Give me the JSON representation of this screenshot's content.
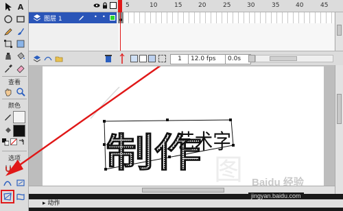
{
  "tools": {
    "view_label": "查看",
    "color_label": "颜色",
    "options_label": "选项"
  },
  "timeline": {
    "layer_name": "图层 1",
    "ruler_numbers": [
      "5",
      "10",
      "15",
      "20",
      "25",
      "30",
      "35",
      "40",
      "45"
    ],
    "current_frame": "1",
    "fps": "12.0 fps",
    "time": "0.0s"
  },
  "stage": {
    "main_text": "制作艺术字"
  },
  "actions_panel": {
    "title": "▸ 动作"
  },
  "watermark": {
    "site": "jingyan.baidu.com",
    "logo_text": "Baidu 经验"
  },
  "colors": {
    "selected_layer": "#2a55b8",
    "playhead": "#e01818",
    "highlight": "#e01818"
  }
}
